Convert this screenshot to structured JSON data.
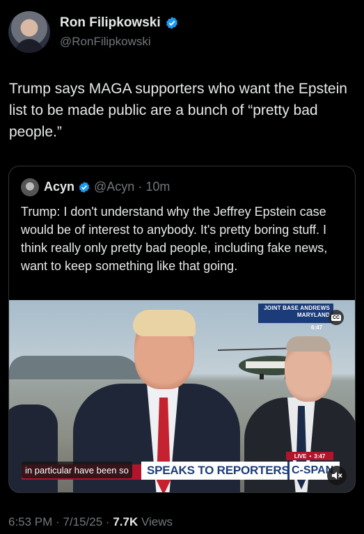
{
  "author": {
    "name": "Ron Filipkowski",
    "handle": "@RonFilipkowski"
  },
  "tweet": {
    "text": "Trump says MAGA supporters who want the Epstein list to be made public are a bunch of “pretty bad people.”"
  },
  "quoted": {
    "name": "Acyn",
    "handle": "@Acyn",
    "separator": "·",
    "age": "10m",
    "text": "Trump: I don't understand why the Jeffrey Epstein case would be of interest to anybody. It's pretty boring stuff. I think really only pretty bad people, including fake news, want to keep something like that going."
  },
  "video": {
    "location_line1": "JOINT BASE ANDREWS",
    "location_line2": "MARYLAND",
    "location_time": "6:47",
    "cc_label": "CC",
    "live_label": "LIVE",
    "live_dot": "•",
    "live_time": "3:47",
    "chyron": "SPEAKS TO REPORTERS",
    "network": "C-SPAN",
    "caption": "in particular have been so"
  },
  "footer": {
    "time": "6:53 PM",
    "sep1": "·",
    "date": "7/15/25",
    "sep2": "·",
    "views_count": "7.7K",
    "views_label": "Views"
  },
  "colors": {
    "verified": "#1d9bf0",
    "secondary_text": "#71767b",
    "live_red": "#b0152c",
    "cspan_blue": "#1b3c78"
  }
}
